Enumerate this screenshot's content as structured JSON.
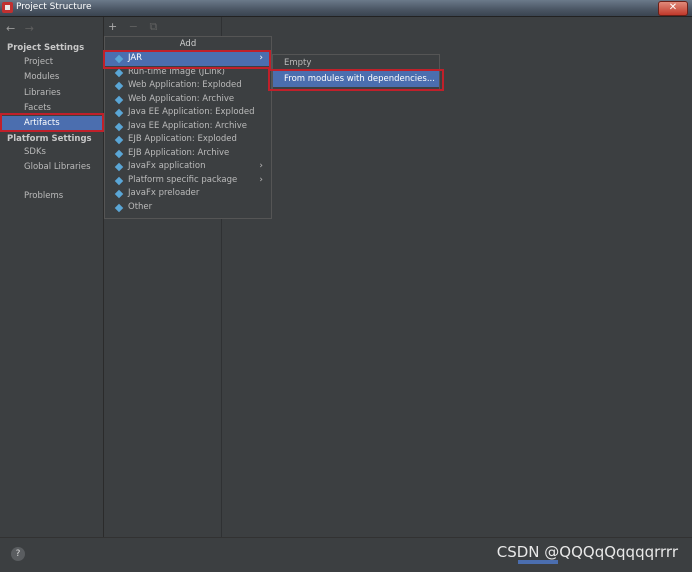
{
  "window": {
    "title": "Project Structure",
    "close_glyph": "✕"
  },
  "nav": {
    "back_glyph": "←",
    "forward_glyph": "→",
    "project_settings_heading": "Project Settings",
    "project_items": [
      "Project",
      "Modules",
      "Libraries",
      "Facets",
      "Artifacts"
    ],
    "platform_settings_heading": "Platform Settings",
    "platform_items": [
      "SDKs",
      "Global Libraries"
    ],
    "problems": "Problems",
    "selected": "Artifacts"
  },
  "toolbar": {
    "add": "+",
    "remove": "−",
    "copy": "⧉"
  },
  "add_popup": {
    "title": "Add",
    "items": [
      {
        "label": "JAR",
        "has_submenu": true
      },
      {
        "label": "Run-time image (JLink)",
        "has_submenu": false
      },
      {
        "label": "Web Application: Exploded",
        "has_submenu": false
      },
      {
        "label": "Web Application: Archive",
        "has_submenu": false
      },
      {
        "label": "Java EE Application: Exploded",
        "has_submenu": false
      },
      {
        "label": "Java EE Application: Archive",
        "has_submenu": false
      },
      {
        "label": "EJB Application: Exploded",
        "has_submenu": false
      },
      {
        "label": "EJB Application: Archive",
        "has_submenu": false
      },
      {
        "label": "JavaFx application",
        "has_submenu": true
      },
      {
        "label": "Platform specific package",
        "has_submenu": true
      },
      {
        "label": "JavaFx preloader",
        "has_submenu": false
      },
      {
        "label": "Other",
        "has_submenu": false
      }
    ],
    "submenu_arrow": "›"
  },
  "jar_submenu": {
    "items": [
      "Empty",
      "From modules with dependencies..."
    ]
  },
  "bottom": {
    "help": "?",
    "watermark": "CSDN @QQQqQqqqqrrrr"
  },
  "colors": {
    "accent": "#4b6eaf",
    "highlight_border": "#c0202a",
    "background": "#3c3f41"
  }
}
